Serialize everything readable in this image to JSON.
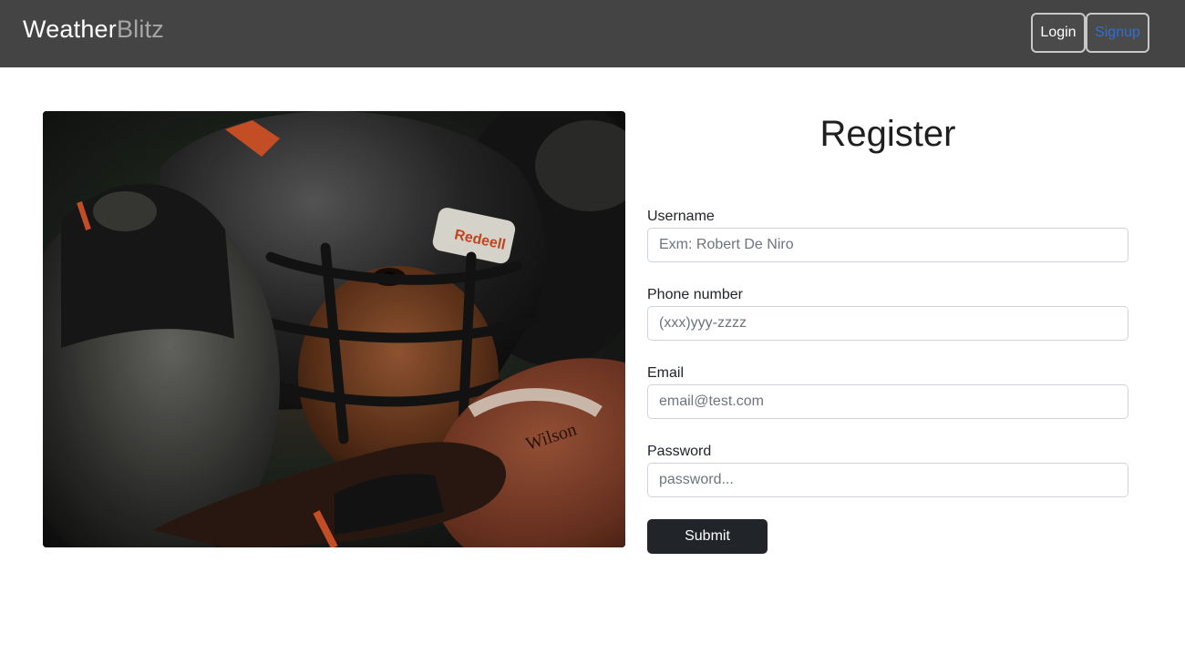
{
  "navbar": {
    "brand_primary": "Weather",
    "brand_secondary": "Blitz",
    "login_label": "Login",
    "signup_label": "Signup"
  },
  "hero": {
    "description": "football-player-photo",
    "helmet_text": "Redeell",
    "ball_text": "Wilson"
  },
  "form": {
    "title": "Register",
    "fields": [
      {
        "label": "Username",
        "placeholder": "Exm: Robert De Niro",
        "value": ""
      },
      {
        "label": "Phone number",
        "placeholder": "(xxx)yyy-zzzz",
        "value": ""
      },
      {
        "label": "Email",
        "placeholder": "email@test.com",
        "value": ""
      },
      {
        "label": "Password",
        "placeholder": "password...",
        "value": ""
      }
    ],
    "submit_label": "Submit"
  },
  "colors": {
    "navbar_bg": "#444444",
    "brand_secondary": "#a6a6a6",
    "signup_link": "#2f6fd6",
    "submit_bg": "#212529"
  }
}
